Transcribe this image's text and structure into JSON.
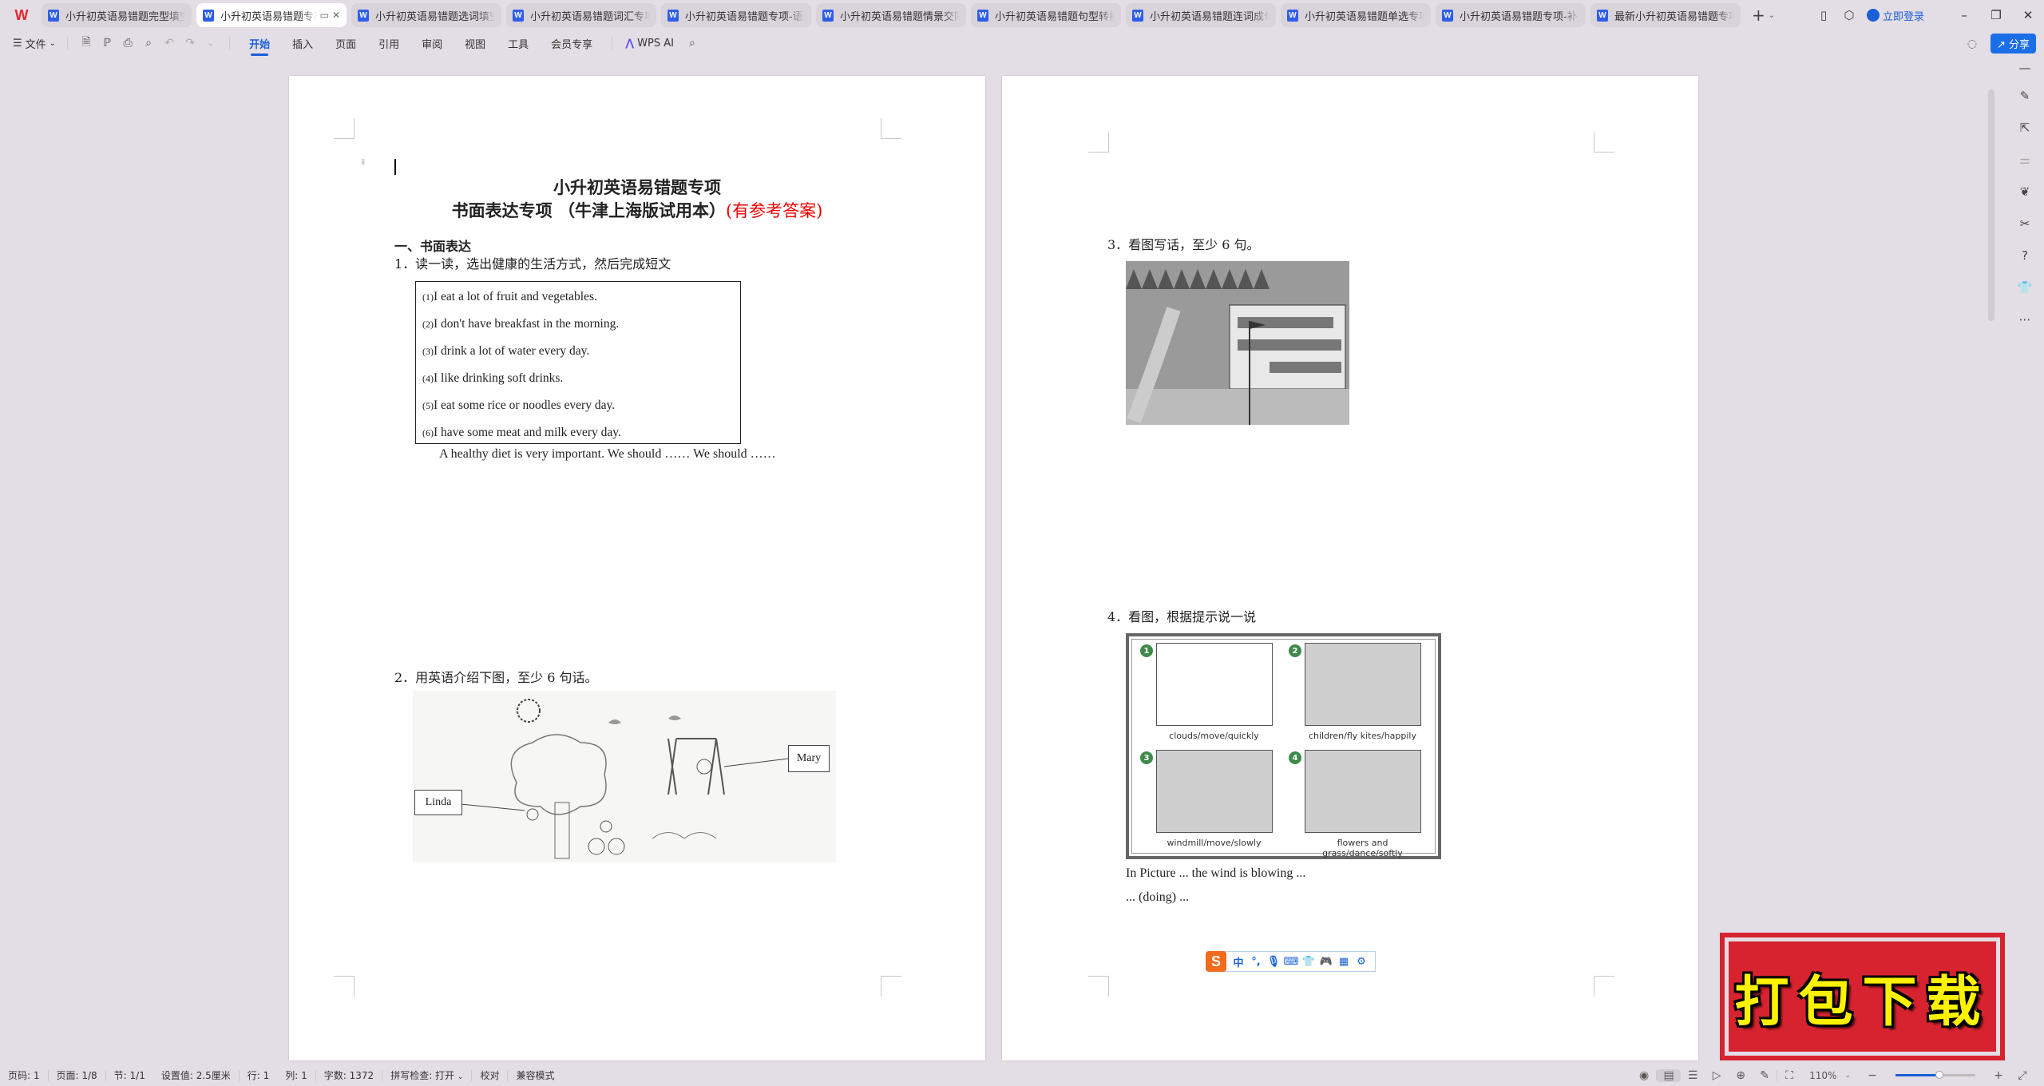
{
  "tabs": [
    {
      "label": "小升初英语易错题完型填空专项",
      "active": false
    },
    {
      "label": "小升初英语易错题专项",
      "active": true
    },
    {
      "label": "小升初英语易错题选词填空专项",
      "active": false
    },
    {
      "label": "小升初英语易错题词汇专项",
      "active": false
    },
    {
      "label": "小升初英语易错题专项-语法专项",
      "active": false
    },
    {
      "label": "小升初英语易错题情景交际专项",
      "active": false
    },
    {
      "label": "小升初英语易错题句型转换专项",
      "active": false
    },
    {
      "label": "小升初英语易错题连词成句",
      "active": false
    },
    {
      "label": "小升初英语易错题单选专项",
      "active": false
    },
    {
      "label": "小升初英语易错题专项-补全",
      "active": false
    },
    {
      "label": "最新小升初英语易错题专项-",
      "active": false
    }
  ],
  "titlebar": {
    "login_label": "立即登录"
  },
  "toolbar": {
    "file_label": "文件",
    "ribbon_tabs": [
      "开始",
      "插入",
      "页面",
      "引用",
      "审阅",
      "视图",
      "工具",
      "会员专享"
    ],
    "active_ribbon_tab": "开始",
    "wps_ai_label": "WPS AI",
    "share_label": "分享"
  },
  "document": {
    "title_line1": "小升初英语易错题专项",
    "title_line2": "书面表达专项 （牛津上海版试用本）",
    "title_line2_red": "(有参考答案)",
    "section1_heading": "一、书面表达",
    "q1": "1．读一读，选出健康的生活方式，然后完成短文",
    "q1_options": [
      {
        "num": "(1)",
        "text": "I eat a lot of fruit and vegetables."
      },
      {
        "num": "(2)",
        "text": "I don't have breakfast in the morning."
      },
      {
        "num": "(3)",
        "text": "I drink a lot of water every day."
      },
      {
        "num": "(4)",
        "text": "I like drinking soft drinks."
      },
      {
        "num": "(5)",
        "text": "I eat some rice or noodles every day."
      },
      {
        "num": "(6)",
        "text": "I have some meat and milk every day."
      }
    ],
    "q1_prompt": "A healthy diet is very important. We should …… We should ……",
    "q2": "2．用英语介绍下图，至少 6 句话。",
    "q2_labels": {
      "left": "Linda",
      "right": "Mary"
    },
    "q3": "3．看图写话，至少 6 句。",
    "q4": "4．看图，根据提示说一说",
    "q4_panels": [
      {
        "num": "1",
        "caption": "clouds/move/quickly"
      },
      {
        "num": "2",
        "caption": "children/fly kites/happily"
      },
      {
        "num": "3",
        "caption": "windmill/move/slowly"
      },
      {
        "num": "4",
        "caption": "flowers and grass/dance/softly"
      }
    ],
    "q4_prompt_line1": "In Picture ... the wind is blowing ...",
    "q4_prompt_line2": "... (doing) ..."
  },
  "ime": {
    "mode": "中",
    "punct": "°,"
  },
  "stamp": {
    "label": "打包下载"
  },
  "statusbar": {
    "page_code": "页码: 1",
    "page": "页面: 1/8",
    "section": "节: 1/1",
    "setting": "设置值: 2.5厘米",
    "row": "行: 1",
    "col": "列: 1",
    "word_count": "字数: 1372",
    "spell_check": "拼写检查: 打开",
    "proofread": "校对",
    "compat_mode": "兼容模式",
    "zoom_level": "110%",
    "zoom_fraction": 0.55
  }
}
